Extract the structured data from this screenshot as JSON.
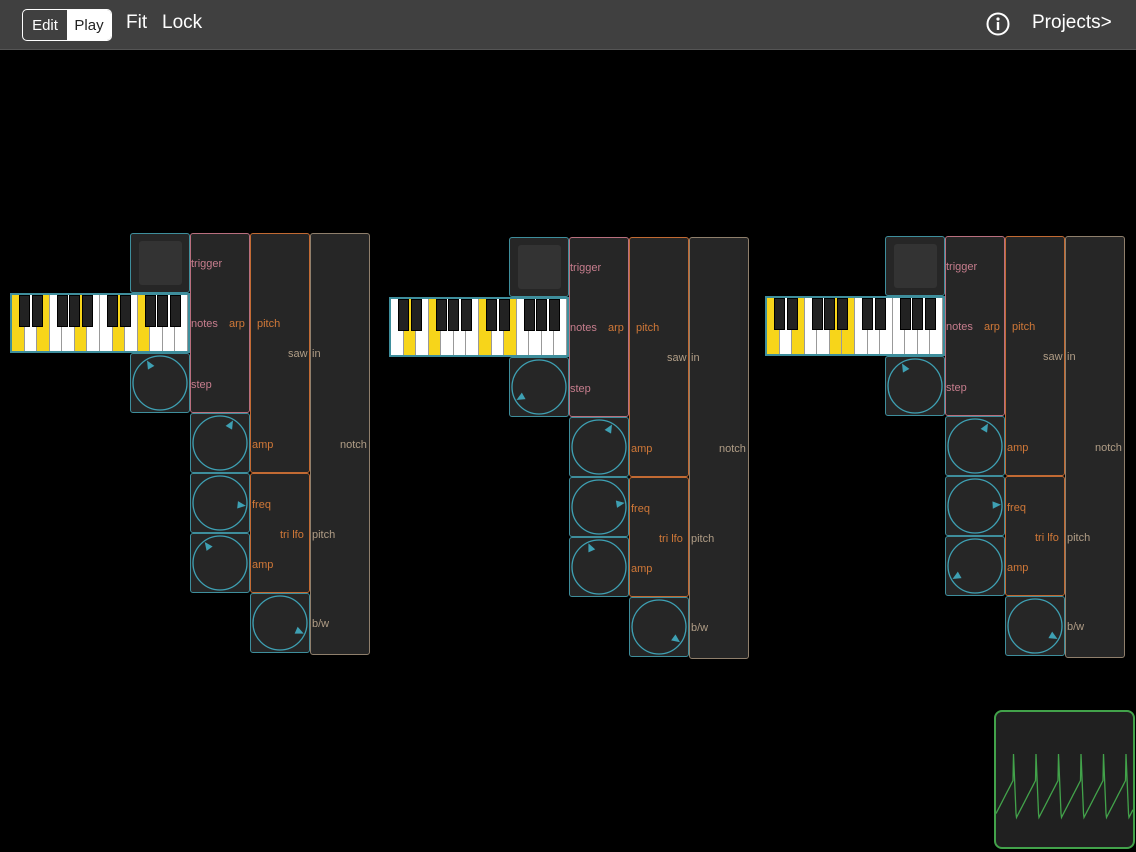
{
  "toolbar": {
    "edit_label": "Edit",
    "play_label": "Play",
    "selected_mode": "Play",
    "fit_label": "Fit",
    "lock_label": "Lock",
    "info_icon": "info-icon",
    "projects_label": "Projects>"
  },
  "patch_labels": {
    "trigger": "trigger",
    "notes": "notes",
    "step": "step",
    "arp": "arp",
    "pitch": "pitch",
    "saw": "saw",
    "in": "in",
    "notch": "notch",
    "amp": "amp",
    "freq": "freq",
    "tri_lfo": "tri lfo",
    "bw": "b/w"
  },
  "clusters": [
    {
      "lit_keys": [
        0,
        2,
        5,
        8,
        10
      ],
      "knob_levels": {
        "step": 0.4,
        "amp": 0.6,
        "freq": 0.82,
        "amp2": 0.38,
        "bw": 0.88
      }
    },
    {
      "lit_keys": [
        1,
        3,
        7,
        9
      ],
      "knob_levels": {
        "step": 0.1,
        "amp": 0.6,
        "freq": 0.77,
        "amp2": 0.42,
        "bw": 0.92
      }
    },
    {
      "lit_keys": [
        0,
        2,
        5,
        6
      ],
      "knob_levels": {
        "step": 0.4,
        "amp": 0.6,
        "freq": 0.79,
        "amp2": 0.1,
        "bw": 0.9
      }
    }
  ],
  "colors": {
    "toolbar_bg": "#404040",
    "blue_module": "#3e8e9c",
    "pink_module": "#b96f7e",
    "orange_module": "#c26a33",
    "tan_module": "#8f7f6c",
    "key_highlight": "#f7d51a",
    "scope_green": "#42a24a"
  }
}
